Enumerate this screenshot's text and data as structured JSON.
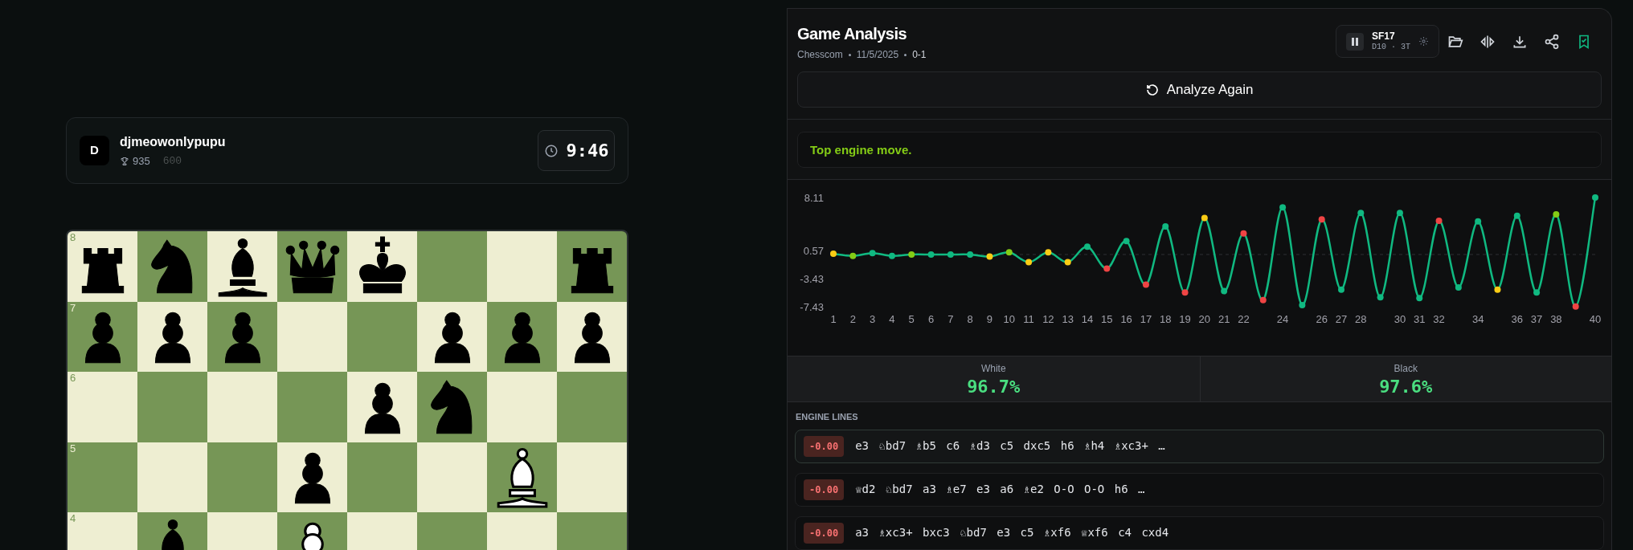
{
  "player": {
    "avatar_letter": "D",
    "name": "djmeowonlypupu",
    "rating": "935",
    "secondary": "600",
    "clock": "9:46"
  },
  "board": {
    "ranks": [
      {
        "label": "8",
        "squares": [
          {
            "kind": "black_rook"
          },
          {
            "kind": "black_knight"
          },
          {
            "kind": "black_bishop"
          },
          {
            "kind": "black_queen"
          },
          {
            "kind": "black_king"
          },
          {
            "kind": "empty"
          },
          {
            "kind": "empty"
          },
          {
            "kind": "black_rook"
          }
        ]
      },
      {
        "label": "7",
        "squares": [
          {
            "kind": "black_pawn"
          },
          {
            "kind": "black_pawn"
          },
          {
            "kind": "black_pawn"
          },
          {
            "kind": "empty"
          },
          {
            "kind": "empty"
          },
          {
            "kind": "black_pawn"
          },
          {
            "kind": "black_pawn"
          },
          {
            "kind": "black_pawn"
          }
        ]
      },
      {
        "label": "6",
        "squares": [
          {
            "kind": "empty"
          },
          {
            "kind": "empty"
          },
          {
            "kind": "empty"
          },
          {
            "kind": "empty"
          },
          {
            "kind": "black_pawn"
          },
          {
            "kind": "black_knight"
          },
          {
            "kind": "empty"
          },
          {
            "kind": "empty"
          }
        ]
      },
      {
        "label": "5",
        "squares": [
          {
            "kind": "empty"
          },
          {
            "kind": "empty"
          },
          {
            "kind": "empty"
          },
          {
            "kind": "black_pawn"
          },
          {
            "kind": "empty"
          },
          {
            "kind": "empty"
          },
          {
            "kind": "white_bishop"
          },
          {
            "kind": "empty"
          }
        ]
      },
      {
        "label": "4",
        "squares": [
          {
            "kind": "empty"
          },
          {
            "kind": "black_bishop"
          },
          {
            "kind": "empty"
          },
          {
            "kind": "white_pawn"
          },
          {
            "kind": "empty"
          },
          {
            "kind": "empty"
          },
          {
            "kind": "empty"
          },
          {
            "kind": "empty"
          }
        ]
      }
    ]
  },
  "analysis": {
    "title": "Game Analysis",
    "meta": [
      "Chesscom",
      "11/5/2025",
      "0-1"
    ],
    "engine": {
      "name": "SF17",
      "settings": "D10 · 3T"
    },
    "analyze_button": "Analyze Again",
    "feedback": "Top engine move.",
    "chart_data": {
      "type": "line",
      "x": [
        1,
        2,
        3,
        4,
        5,
        6,
        7,
        8,
        9,
        10,
        11,
        12,
        13,
        14,
        15,
        16,
        17,
        18,
        19,
        20,
        21,
        22,
        23,
        24,
        25,
        26,
        27,
        28,
        29,
        30,
        31,
        32,
        33,
        34,
        35,
        36,
        37,
        38,
        39,
        40
      ],
      "xlim": [
        1,
        40
      ],
      "ylim": [
        -7.43,
        8.11
      ],
      "xticks": [
        1,
        2,
        3,
        4,
        5,
        6,
        7,
        8,
        9,
        10,
        11,
        12,
        13,
        14,
        15,
        16,
        17,
        18,
        19,
        20,
        21,
        22,
        24,
        26,
        27,
        28,
        30,
        31,
        32,
        34,
        36,
        37,
        38,
        40
      ],
      "yticks": [
        8.11,
        0.57,
        -3.43,
        -7.43
      ],
      "ref_lines": [
        {
          "axis": "y",
          "value": 0
        }
      ],
      "series": [
        {
          "color": "#10b981",
          "marker": "o",
          "values": [
            0.1,
            -0.2,
            0.2,
            -0.2,
            0,
            0,
            0,
            0,
            -0.3,
            0.3,
            -1.1,
            0.3,
            -1.1,
            1.1,
            -2,
            1.9,
            -4.3,
            4,
            -5.4,
            5.2,
            -5.2,
            3,
            -6.5,
            6.7,
            -7.2,
            5,
            -5,
            5.9,
            -6.1,
            5.9,
            -6.2,
            4.8,
            -4.7,
            4.7,
            -5,
            5.5,
            -5.4,
            5.7,
            -7.4,
            8.1
          ]
        }
      ]
    },
    "move_markers": [
      {
        "color": "#facc15"
      },
      {
        "color": "#84cc16"
      },
      {
        "color": "#10b981"
      },
      {
        "color": "#10b981"
      },
      {
        "color": "#84cc16"
      },
      {
        "color": "#10b981"
      },
      {
        "color": "#10b981"
      },
      {
        "color": "#10b981"
      },
      {
        "color": "#facc15"
      },
      {
        "color": "#84cc16"
      },
      {
        "color": "#facc15"
      },
      {
        "color": "#facc15"
      },
      {
        "color": "#facc15"
      },
      {
        "color": "#10b981"
      },
      {
        "color": "#ef4444"
      },
      {
        "color": "#10b981"
      },
      {
        "color": "#ef4444"
      },
      {
        "color": "#10b981"
      },
      {
        "color": "#ef4444"
      },
      {
        "color": "#facc15"
      },
      {
        "color": "#10b981"
      },
      {
        "color": "#ef4444"
      },
      {
        "color": "#ef4444"
      },
      {
        "color": "#10b981"
      },
      {
        "color": "#10b981"
      },
      {
        "color": "#ef4444"
      },
      {
        "color": "#10b981"
      },
      {
        "color": "#10b981"
      },
      {
        "color": "#10b981"
      },
      {
        "color": "#10b981"
      },
      {
        "color": "#10b981"
      },
      {
        "color": "#ef4444"
      },
      {
        "color": "#10b981"
      },
      {
        "color": "#10b981"
      },
      {
        "color": "#facc15"
      },
      {
        "color": "#10b981"
      },
      {
        "color": "#10b981"
      },
      {
        "color": "#84cc16"
      },
      {
        "color": "#ef4444"
      },
      {
        "color": "#10b981"
      }
    ],
    "accuracy": [
      {
        "label": "White",
        "value": "96.7%"
      },
      {
        "label": "Black",
        "value": "97.6%"
      }
    ],
    "engine_lines_title": "ENGINE LINES",
    "engine_lines": [
      {
        "eval": "-0.00",
        "moves": "e3 ♘bd7 ♗b5 c6 ♗d3 c5 dxc5 h6 ♗h4 ♗xc3+ …",
        "selected": true
      },
      {
        "eval": "-0.00",
        "moves": "♕d2 ♘bd7 a3 ♗e7 e3 a6 ♗e2 O-O O-O h6 …",
        "selected": false
      },
      {
        "eval": "-0.00",
        "moves": "a3 ♗xc3+ bxc3 ♘bd7 e3 c5 ♗xf6 ♕xf6 c4 cxd4",
        "selected": false
      }
    ]
  }
}
